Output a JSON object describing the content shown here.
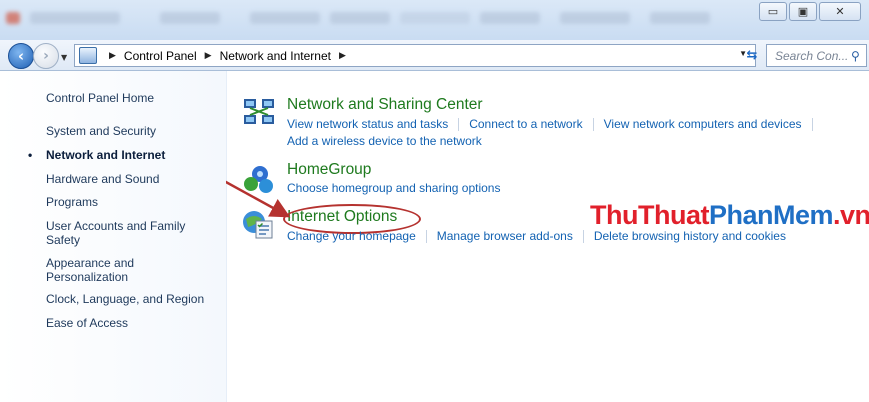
{
  "titlebar": {
    "blurred_items": [
      "",
      "",
      "",
      "",
      "",
      "",
      "",
      ""
    ],
    "buttons": {
      "minimize": "▭",
      "maximize": "▣",
      "close": "✕"
    }
  },
  "address": {
    "crumbs": [
      "Control Panel",
      "Network and Internet"
    ],
    "search_placeholder": "Search Con..."
  },
  "sidebar": {
    "items": [
      {
        "label": "Control Panel Home"
      },
      {
        "label": "System and Security"
      },
      {
        "label": "Network and Internet",
        "active": true
      },
      {
        "label": "Hardware and Sound"
      },
      {
        "label": "Programs"
      },
      {
        "label": "User Accounts and Family Safety"
      },
      {
        "label": "Appearance and Personalization"
      },
      {
        "label": "Clock, Language, and Region"
      },
      {
        "label": "Ease of Access"
      }
    ]
  },
  "categories": [
    {
      "title": "Network and Sharing Center",
      "icon": "network-sharing-icon",
      "links": [
        "View network status and tasks",
        "Connect to a network",
        "View network computers and devices",
        "Add a wireless device to the network"
      ]
    },
    {
      "title": "HomeGroup",
      "icon": "homegroup-icon",
      "links": [
        "Choose homegroup and sharing options"
      ]
    },
    {
      "title": "Internet Options",
      "icon": "internet-options-icon",
      "links": [
        "Change your homepage",
        "Manage browser add-ons",
        "Delete browsing history and cookies"
      ]
    }
  ],
  "watermark": {
    "part1": "ThuThuat",
    "part2": "PhanMem",
    "part3": ".vn"
  },
  "colors": {
    "link": "#1362b2",
    "category_title": "#1e7a1e",
    "highlight": "#b5322f",
    "watermark_red": "#e1202b",
    "watermark_blue": "#1f6fc5"
  }
}
